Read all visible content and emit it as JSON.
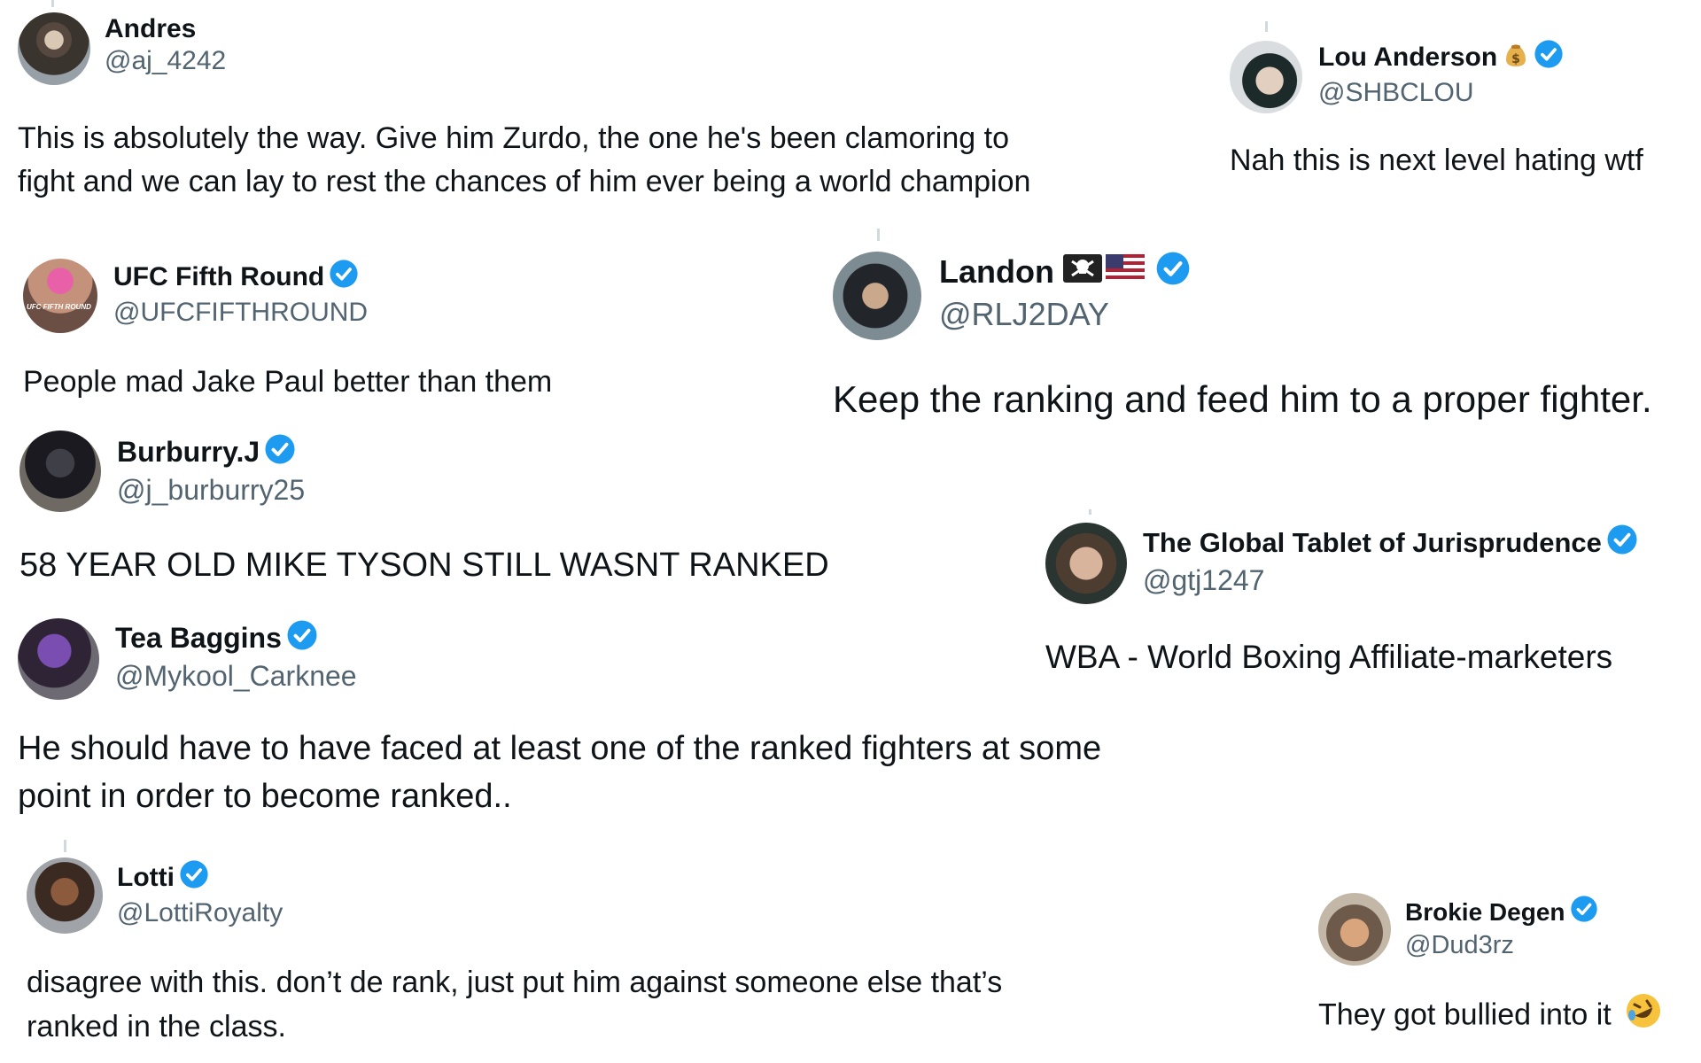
{
  "tweets": [
    {
      "name": "Andres",
      "handle": "@aj_4242",
      "verified": false,
      "text": "This is absolutely the way. Give him Zurdo, the one he's been clamoring to fight and we can lay to rest the chances of him ever being a world champion"
    },
    {
      "name": "Lou Anderson",
      "handle": "@SHBCLOU",
      "verified": true,
      "name_emoji": "money-bag-icon",
      "text": "Nah this is next level hating wtf"
    },
    {
      "name": "UFC Fifth Round",
      "handle": "@UFCFIFTHROUND",
      "verified": true,
      "text": "People mad Jake Paul better than them"
    },
    {
      "name": "Landon",
      "handle": "@RLJ2DAY",
      "verified": true,
      "name_emoji": "pirate-flag-and-us-flag-icons",
      "text": "Keep the ranking and feed him to a proper fighter."
    },
    {
      "name": "Burburry.J",
      "handle": "@j_burburry25",
      "verified": true,
      "text": "58 YEAR OLD MIKE TYSON STILL WASNT RANKED"
    },
    {
      "name": "The Global Tablet of Jurisprudence",
      "handle": "@gtj1247",
      "verified": true,
      "text": "WBA - World Boxing Affiliate-marketers"
    },
    {
      "name": "Tea Baggins",
      "handle": "@Mykool_Carknee",
      "verified": true,
      "text": "He should have to have faced at least one of the ranked fighters at some point in order to become ranked.."
    },
    {
      "name": "Lotti",
      "handle": "@LottiRoyalty",
      "verified": true,
      "text": "disagree with this. don’t de rank, just put him against someone else that’s ranked in the class."
    },
    {
      "name": "Brokie Degen",
      "handle": "@Dud3rz",
      "verified": true,
      "text_emoji": "rolling-on-floor-laughing-icon",
      "text": "They got bullied into it"
    }
  ],
  "avatar_text": {
    "ufc": "UFC FIFTH ROUND"
  },
  "colors": {
    "verified": "#1d9bf0",
    "handle": "#536471",
    "text": "#0f1419"
  }
}
